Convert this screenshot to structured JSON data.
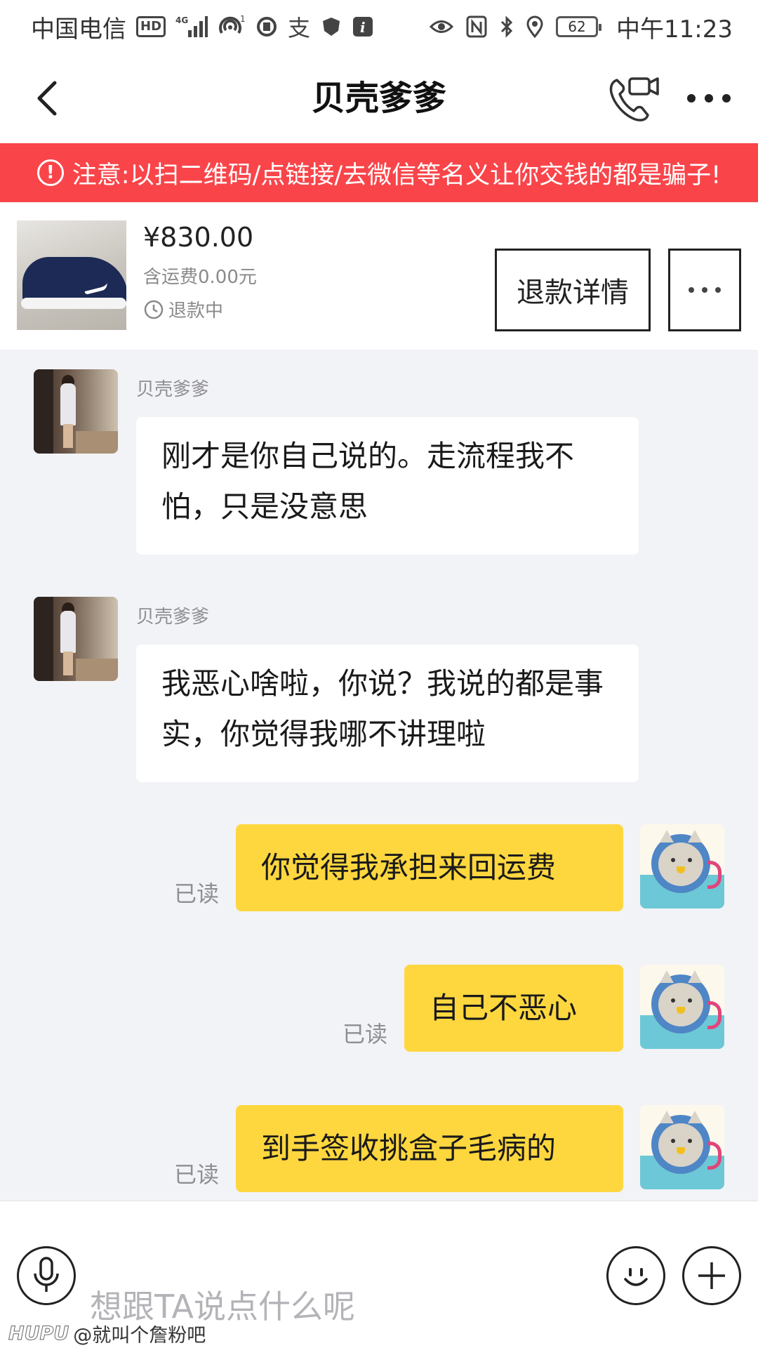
{
  "status_bar": {
    "carrier": "中国电信",
    "hd_badge": "HD",
    "network": "4G",
    "hotspot_count": "1",
    "battery_level": "62",
    "time": "中午11:23",
    "icons": [
      "signal-icon",
      "hotspot-icon",
      "sync-icon",
      "alipay-icon",
      "shield-icon",
      "info-icon",
      "eye-icon",
      "nfc-icon",
      "bluetooth-icon",
      "location-icon",
      "battery-icon"
    ]
  },
  "header": {
    "title": "贝壳爹爹",
    "back_icon": "back-arrow-icon",
    "call_icon": "phone-video-icon",
    "more_icon": "more-dots-icon"
  },
  "warning": {
    "text": "注意:以扫二维码/点链接/去微信等名义让你交钱的都是骗子!",
    "icon": "exclamation-icon",
    "color": "#f9454a"
  },
  "product": {
    "price": "¥830.00",
    "shipping": "含运费0.00元",
    "status": "退款中",
    "refund_button": "退款详情",
    "more_icon": "more-dots-icon"
  },
  "messages": [
    {
      "direction": "in",
      "sender": "贝壳爹爹",
      "text": "刚才是你自己说的。走流程我不怕，只是没意思"
    },
    {
      "direction": "in",
      "sender": "贝壳爹爹",
      "text": "我恶心啥啦，你说？我说的都是事实，你觉得我哪不讲理啦"
    },
    {
      "direction": "out",
      "status": "已读",
      "text": "你觉得我承担来回运费"
    },
    {
      "direction": "out",
      "status": "已读",
      "text": "自己不恶心"
    },
    {
      "direction": "out",
      "status": "已读",
      "text": "到手签收挑盒子毛病的"
    }
  ],
  "input": {
    "placeholder": "想跟TA说点什么呢",
    "voice_icon": "microphone-icon",
    "emoji_icon": "smile-icon",
    "plus_icon": "plus-icon"
  },
  "watermark": {
    "brand": "HUPU",
    "text": "@就叫个詹粉吧"
  },
  "colors": {
    "bubble_out": "#fed73f",
    "bubble_in": "#ffffff",
    "chat_bg": "#f2f3f7"
  }
}
